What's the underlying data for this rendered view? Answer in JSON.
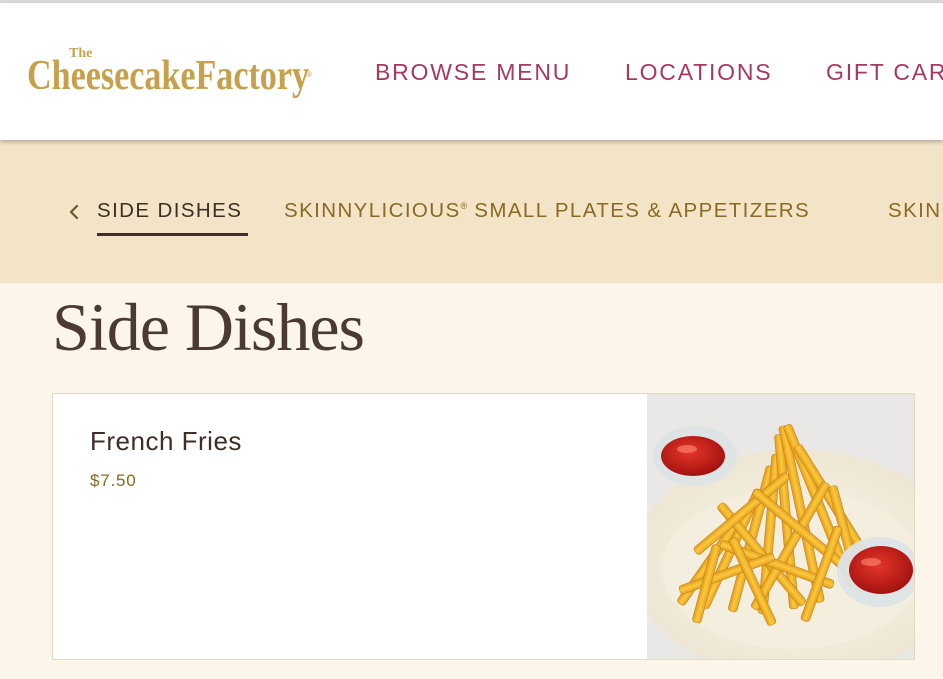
{
  "brand": {
    "logo_top": "The",
    "logo_text": "CheesecakeFactory",
    "logo_color": "#c6a04b",
    "reg_mark": "®"
  },
  "header": {
    "nav": [
      {
        "label": "BROWSE MENU"
      },
      {
        "label": "LOCATIONS"
      },
      {
        "label": "GIFT CAR"
      }
    ],
    "nav_color": "#a8385e"
  },
  "subnav": {
    "prev_icon": "chevron-left-icon",
    "items": [
      {
        "label": "SIDE DISHES",
        "active": true
      },
      {
        "label": "SKINNYLICIOUS",
        "sup": "®",
        "rest": " SMALL PLATES & APPETIZERS",
        "active": false
      },
      {
        "label": "SKIN",
        "active": false
      }
    ],
    "bg_color": "#f3e4c8",
    "active_color": "#3d2e26",
    "item_color": "#8a6a20"
  },
  "main": {
    "title": "Side Dishes",
    "items": [
      {
        "name": "French Fries",
        "price": "$7.50",
        "image": "french-fries-with-ketchup-photo"
      }
    ]
  }
}
